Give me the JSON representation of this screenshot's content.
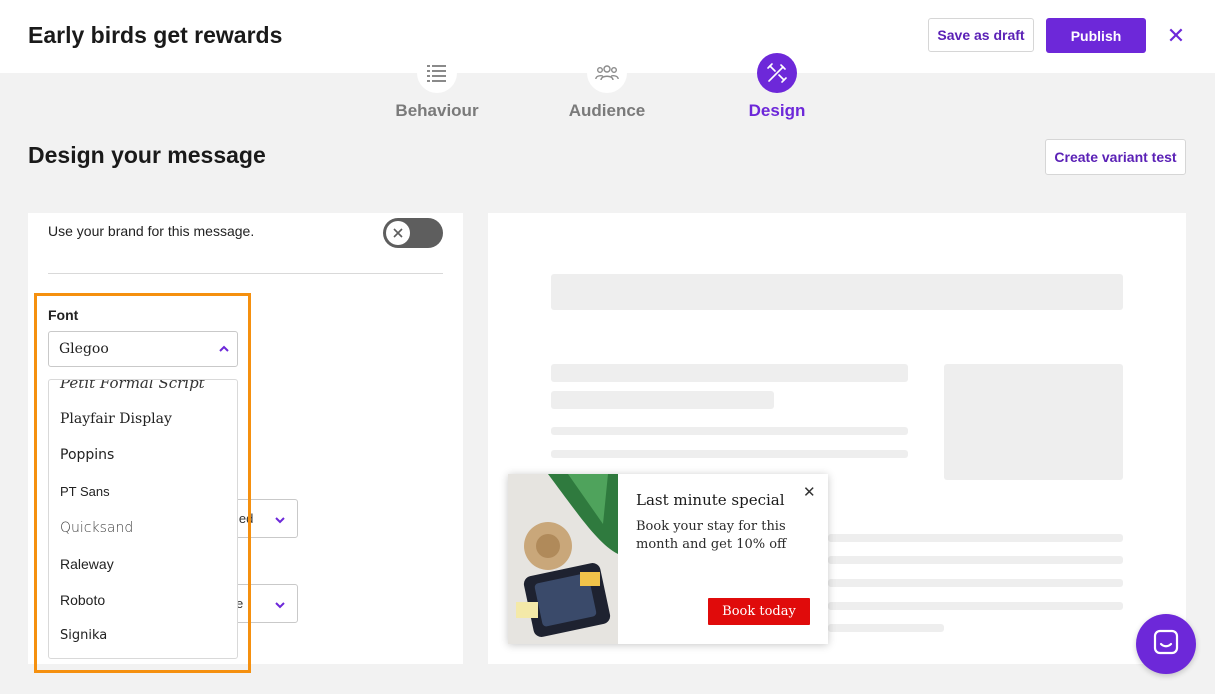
{
  "header": {
    "title": "Early birds get rewards",
    "save_draft_label": "Save as draft",
    "publish_label": "Publish",
    "close_symbol": "✕"
  },
  "steps": [
    {
      "label": "Behaviour",
      "icon": "list-icon",
      "active": false
    },
    {
      "label": "Audience",
      "icon": "people-icon",
      "active": false
    },
    {
      "label": "Design",
      "icon": "design-tools-icon",
      "active": true
    }
  ],
  "main": {
    "heading": "Design your message",
    "variant_button_label": "Create variant test"
  },
  "settings": {
    "brand_toggle_text": "Use your brand for this message.",
    "brand_toggle_on": false,
    "font_label": "Font",
    "font_selected": "Glegoo",
    "hidden_select_2_tail": "led",
    "hidden_select_3_tail": "e"
  },
  "font_options": [
    "Petit Formal Script",
    "Playfair Display",
    "Poppins",
    "PT Sans",
    "Quicksand",
    "Raleway",
    "Roboto",
    "Signika"
  ],
  "popup": {
    "title": "Last minute special",
    "body": "Book your stay for this month and get 10% off",
    "cta": "Book today",
    "close_symbol": "✕"
  },
  "colors": {
    "accent": "#6d28d9",
    "highlight": "#f5900f",
    "cta": "#e00b0b"
  }
}
